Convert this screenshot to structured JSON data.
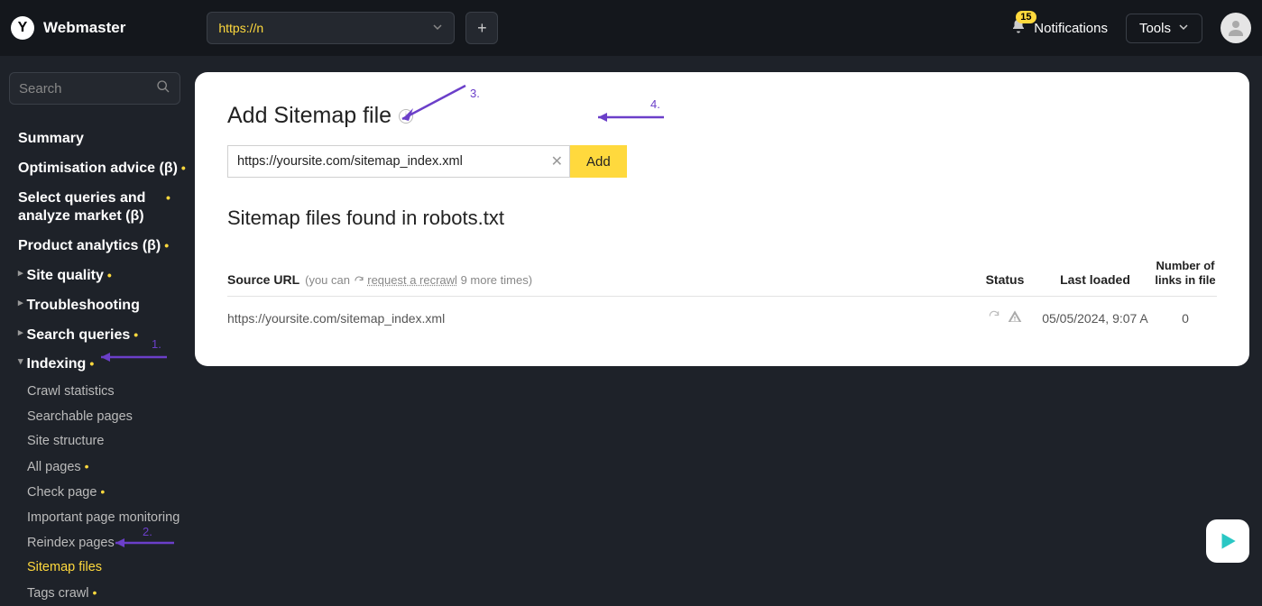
{
  "header": {
    "logo_letter": "Y",
    "logo_text": "Webmaster",
    "site_url": "https://n",
    "notifications_count": "15",
    "notifications_label": "Notifications",
    "tools_label": "Tools"
  },
  "sidebar": {
    "search_placeholder": "Search",
    "items": [
      {
        "label": "Summary",
        "bold": true
      },
      {
        "label": "Optimisation advice (β)",
        "bold": true,
        "dot": true
      },
      {
        "label": "Select queries and analyze market (β)",
        "bold": true,
        "dot": true
      },
      {
        "label": "Product analytics (β)",
        "bold": true,
        "dot": true
      },
      {
        "label": "Site quality",
        "bold": true,
        "caret": true,
        "dot": true
      },
      {
        "label": "Troubleshooting",
        "bold": true,
        "caret": true
      },
      {
        "label": "Search queries",
        "bold": true,
        "caret": true,
        "dot": true
      },
      {
        "label": "Indexing",
        "bold": true,
        "caret": true,
        "dot": true,
        "expanded": true
      }
    ],
    "indexing_children": [
      {
        "label": "Crawl statistics"
      },
      {
        "label": "Searchable pages"
      },
      {
        "label": "Site structure"
      },
      {
        "label": "All pages",
        "dot": true
      },
      {
        "label": "Check page",
        "dot": true
      },
      {
        "label": "Important page monitoring"
      },
      {
        "label": "Reindex pages"
      },
      {
        "label": "Sitemap files",
        "active": true
      },
      {
        "label": "Tags crawl",
        "dot": true
      }
    ]
  },
  "main": {
    "title": "Add Sitemap file",
    "input_value": "https://yoursite.com/sitemap_index.xml",
    "add_button": "Add",
    "subtitle": "Sitemap files found in robots.txt",
    "columns": {
      "source": "Source URL",
      "hint_prefix": "(you can ",
      "hint_link": "request a recrawl",
      "hint_suffix": " 9 more times)",
      "status": "Status",
      "last_loaded": "Last loaded",
      "links": "Number of links in file"
    },
    "rows": [
      {
        "url": "https://yoursite.com/sitemap_index.xml",
        "last_loaded": "05/05/2024, 9:07 A",
        "links": "0"
      }
    ]
  },
  "annotations": {
    "a1": "1.",
    "a2": "2.",
    "a3": "3.",
    "a4": "4."
  }
}
